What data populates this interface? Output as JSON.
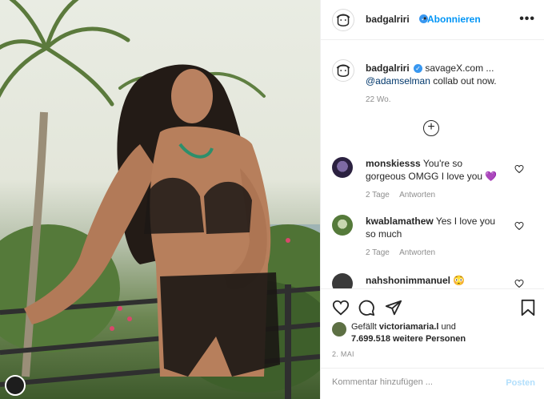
{
  "post": {
    "author": "badgalriri",
    "follow_label": "Abonnieren",
    "more_label": "•••",
    "caption": {
      "username": "badgalriri",
      "text_before": "savageX.com ...",
      "mention": "@adamselman",
      "text_after": " collab out now.",
      "time": "22 Wo."
    },
    "add_comment_icon": "plus-circle-icon"
  },
  "comments": [
    {
      "username": "monskiesss",
      "text": "You're so gorgeous OMGG I love you 💜",
      "time": "2 Tage",
      "reply_label": "Antworten"
    },
    {
      "username": "kwablamathew",
      "text": "Yes I love you so much",
      "time": "2 Tage",
      "reply_label": "Antworten"
    },
    {
      "username": "nahshonimmanuel",
      "text": "😳",
      "time": "",
      "reply_label": ""
    }
  ],
  "actions": {
    "icons": [
      "heart-icon",
      "comment-icon",
      "share-icon",
      "bookmark-icon"
    ],
    "likes": {
      "prefix": "Gefällt ",
      "liker": "victoriamaria.l",
      "middle": " und",
      "count": "7.699.518 weitere Personen"
    },
    "date": "2. MAI",
    "comment_placeholder": "Kommentar hinzufügen ...",
    "post_label": "Posten"
  },
  "colors": {
    "accent": "#0095f6",
    "verified": "#3897f0",
    "muted": "#8e8e8e"
  }
}
